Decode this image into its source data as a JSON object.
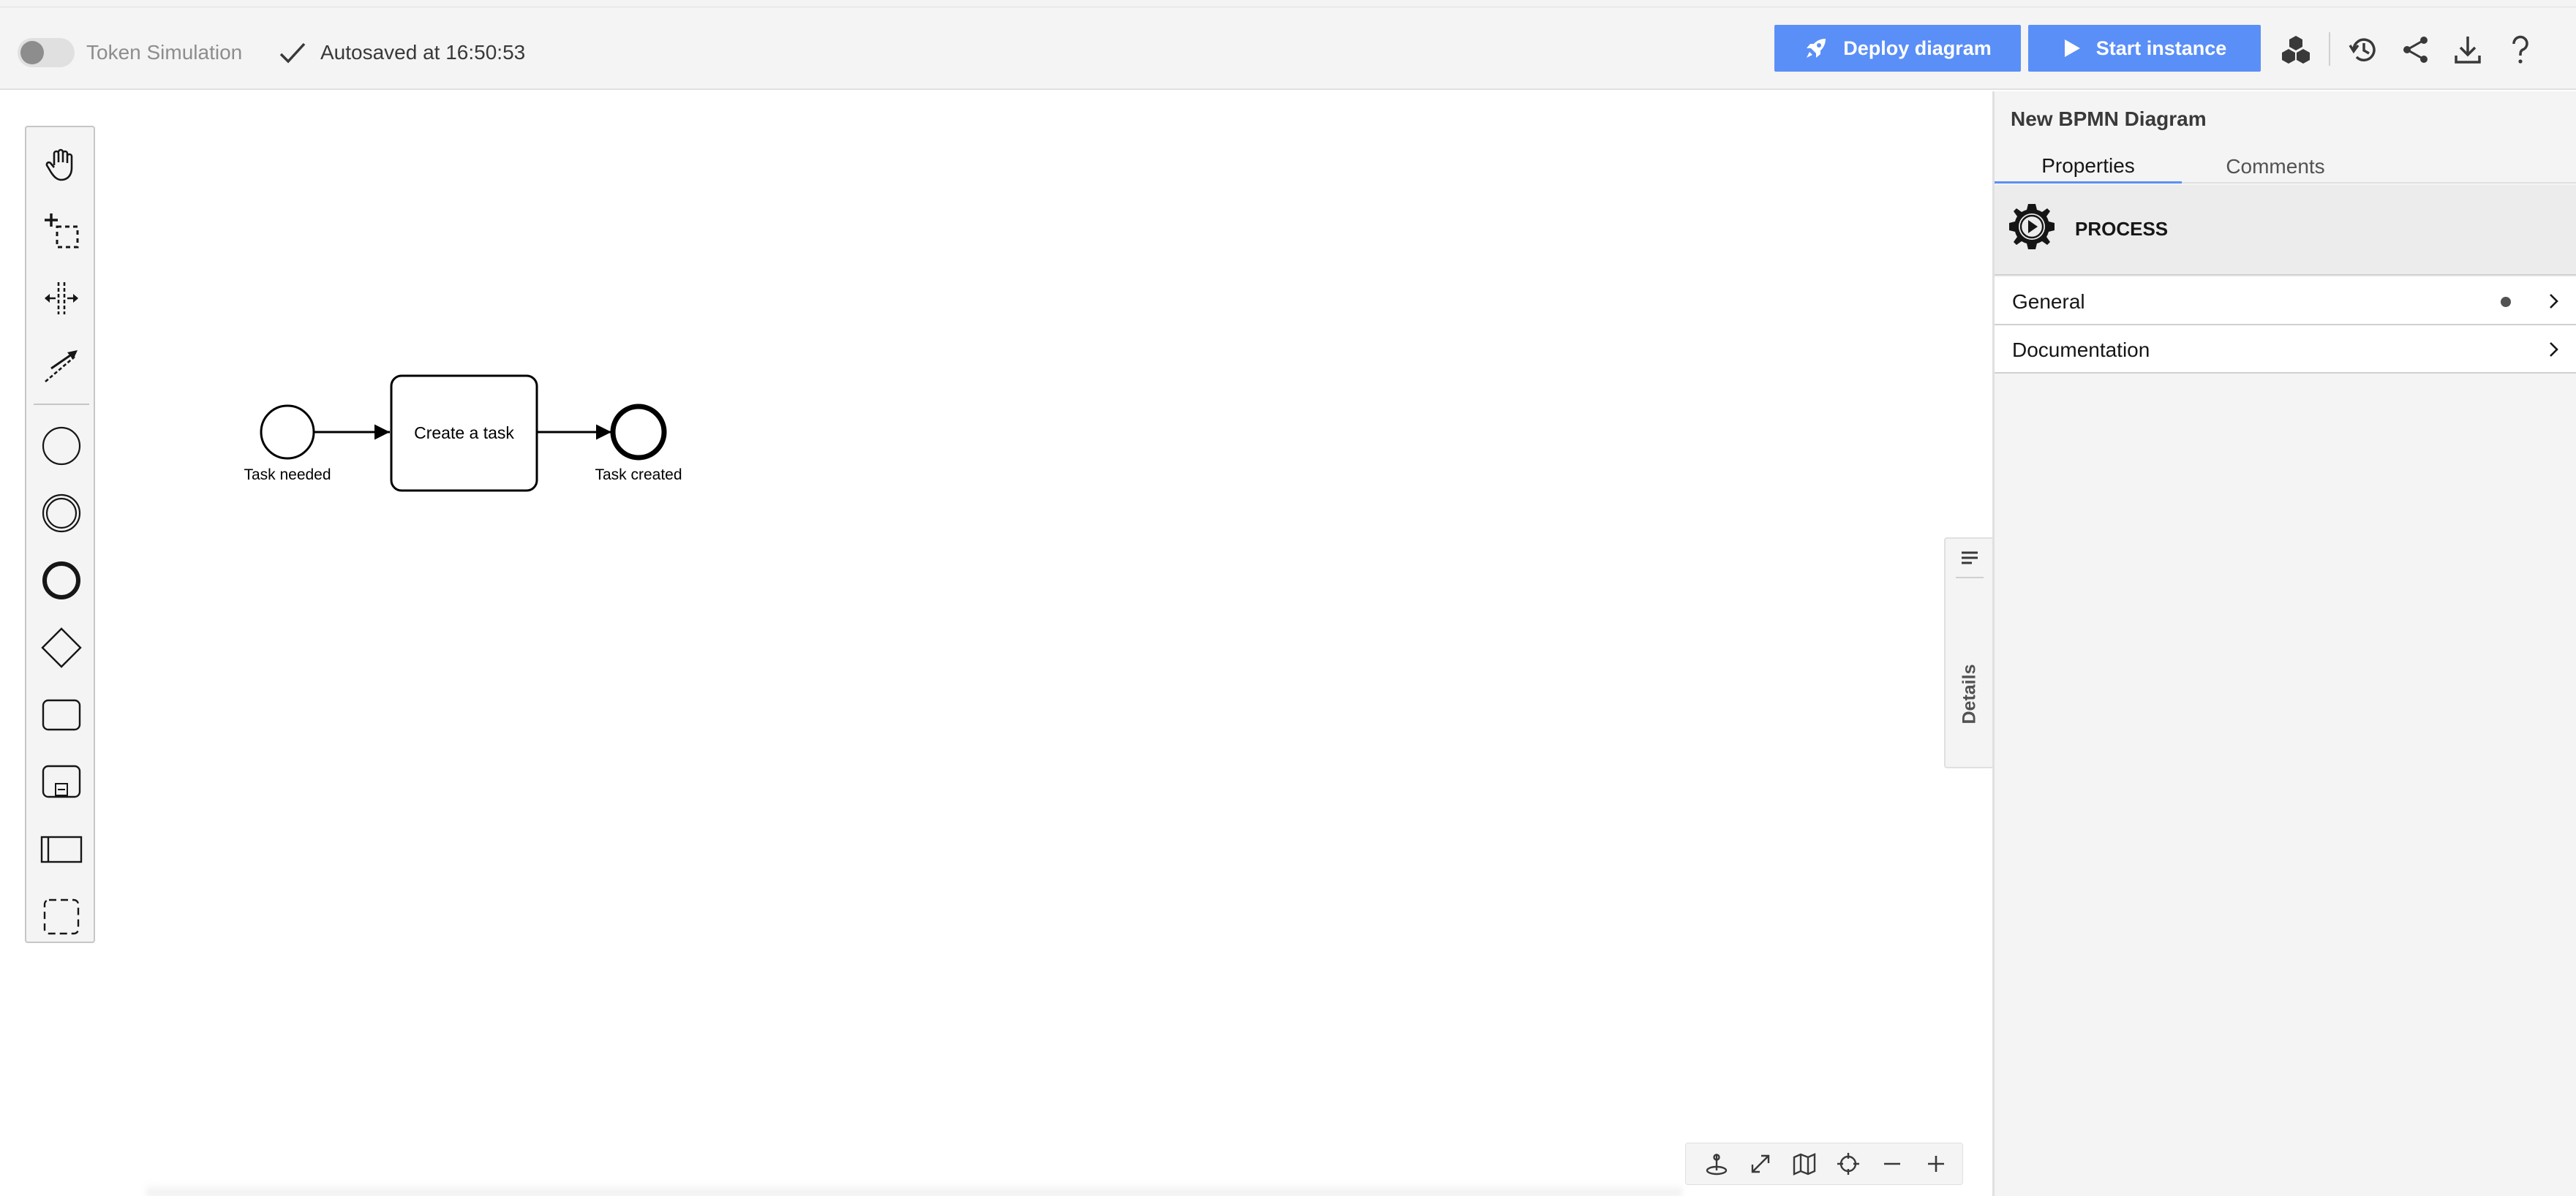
{
  "toolbar": {
    "token_simulation_label": "Token Simulation",
    "token_simulation_enabled": false,
    "autosave_text": "Autosaved at 16:50:53",
    "deploy_label": "Deploy diagram",
    "start_label": "Start instance",
    "icons": [
      "camunda-modeler-icon",
      "history-icon",
      "share-icon",
      "download-icon",
      "help-icon"
    ]
  },
  "palette": {
    "tools": [
      "hand-tool-icon",
      "lasso-tool-icon",
      "space-tool-icon",
      "global-connect-tool-icon"
    ],
    "shapes": [
      "start-event-icon",
      "intermediate-event-icon",
      "end-event-icon",
      "gateway-icon",
      "task-icon",
      "subprocess-icon",
      "pool-icon",
      "group-icon"
    ]
  },
  "diagram": {
    "start_event_label": "Task needed",
    "task_label": "Create a task",
    "end_event_label": "Task created"
  },
  "details_tab": {
    "label": "Details",
    "icon": "list-icon"
  },
  "panel": {
    "title": "New BPMN Diagram",
    "tabs": [
      {
        "label": "Properties",
        "active": true
      },
      {
        "label": "Comments",
        "active": false
      }
    ],
    "element_type": "PROCESS",
    "element_icon": "process-gear-icon",
    "groups": [
      {
        "label": "General",
        "has_entries": true
      },
      {
        "label": "Documentation",
        "has_entries": false
      }
    ]
  },
  "map_controls": [
    "reset-view-icon",
    "fullscreen-icon",
    "minimap-icon",
    "center-icon",
    "zoom-out-icon",
    "zoom-in-icon"
  ],
  "colors": {
    "accent": "#5a8ff7",
    "toolbar_bg": "#f4f4f4",
    "panel_bg": "#f4f4f4"
  }
}
